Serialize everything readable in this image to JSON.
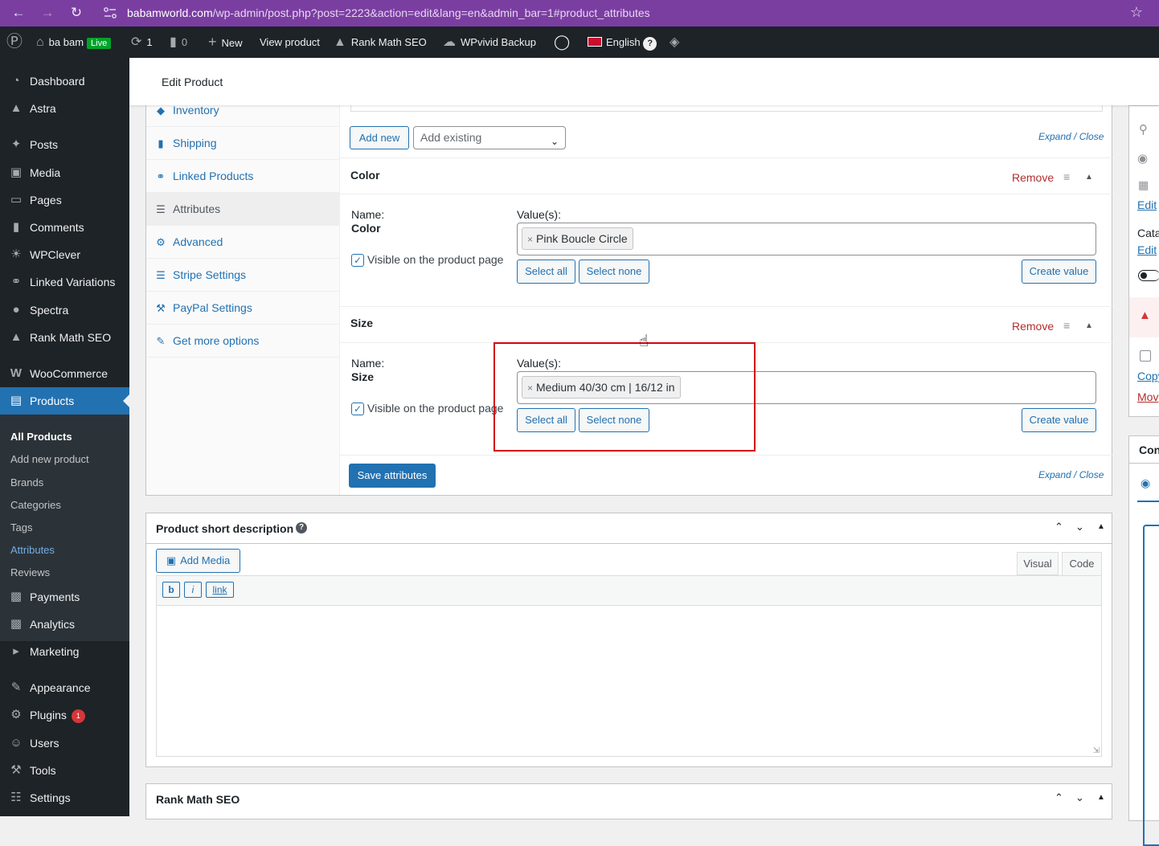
{
  "browser": {
    "url_domain": "babamworld.com",
    "url_path": "/wp-admin/post.php?post=2223&action=edit&lang=en&admin_bar=1#product_attributes"
  },
  "adminbar": {
    "site_name": "ba bam",
    "live_badge": "Live",
    "updates_count": "1",
    "comments_count": "0",
    "new_label": "New",
    "view_product": "View product",
    "rank_math": "Rank Math SEO",
    "wpvivid": "WPvivid Backup",
    "language": "English"
  },
  "sidebar": {
    "items": [
      {
        "label": "Dashboard",
        "icon": "dashboard-icon"
      },
      {
        "label": "Astra",
        "icon": "astra-icon"
      },
      {
        "label": "Posts",
        "icon": "pin-icon"
      },
      {
        "label": "Media",
        "icon": "media-icon"
      },
      {
        "label": "Pages",
        "icon": "page-icon"
      },
      {
        "label": "Comments",
        "icon": "comment-icon"
      },
      {
        "label": "WPClever",
        "icon": "bulb-icon"
      },
      {
        "label": "Linked Variations",
        "icon": "link-icon"
      },
      {
        "label": "Spectra",
        "icon": "spectra-icon"
      },
      {
        "label": "Rank Math SEO",
        "icon": "rankmath-icon"
      },
      {
        "label": "WooCommerce",
        "icon": "woo-icon"
      },
      {
        "label": "Products",
        "icon": "archive-icon"
      },
      {
        "label": "Payments",
        "icon": "payments-icon"
      },
      {
        "label": "Analytics",
        "icon": "chart-icon"
      },
      {
        "label": "Marketing",
        "icon": "megaphone-icon"
      },
      {
        "label": "Appearance",
        "icon": "brush-icon"
      },
      {
        "label": "Plugins",
        "icon": "plugin-icon",
        "badge": "1"
      },
      {
        "label": "Users",
        "icon": "users-icon"
      },
      {
        "label": "Tools",
        "icon": "wrench-icon"
      },
      {
        "label": "Settings",
        "icon": "settings-icon"
      }
    ],
    "submenu": [
      "All Products",
      "Add new product",
      "Brands",
      "Categories",
      "Tags",
      "Attributes",
      "Reviews"
    ]
  },
  "header": {
    "title": "Edit Product"
  },
  "product_data": {
    "tabs": [
      "Inventory",
      "Shipping",
      "Linked Products",
      "Attributes",
      "Advanced",
      "Stripe Settings",
      "PayPal Settings",
      "Get more options"
    ],
    "add_new": "Add new",
    "add_existing_placeholder": "Add existing",
    "expand_close": "Expand / Close",
    "attributes": [
      {
        "title": "Color",
        "remove": "Remove",
        "name_label": "Name:",
        "name_value": "Color",
        "values_label": "Value(s):",
        "value_chip": "Pink Boucle Circle",
        "visible_label": "Visible on the product page",
        "select_all": "Select all",
        "select_none": "Select none",
        "create_value": "Create value"
      },
      {
        "title": "Size",
        "remove": "Remove",
        "name_label": "Name:",
        "name_value": "Size",
        "values_label": "Value(s):",
        "value_chip": "Medium 40/30 cm | 16/12 in",
        "visible_label": "Visible on the product page",
        "select_all": "Select all",
        "select_none": "Select none",
        "create_value": "Create value"
      }
    ],
    "save_attributes": "Save attributes"
  },
  "short_description": {
    "title": "Product short description",
    "add_media": "Add Media",
    "visual_tab": "Visual",
    "code_tab": "Code",
    "qtags": [
      "b",
      "i",
      "link"
    ]
  },
  "rank_math_panel": {
    "title": "Rank Math SEO"
  },
  "right_sidebar": {
    "edit1": "Edit",
    "cata": "Cata",
    "edit2": "Edit",
    "copy": "Copy",
    "move": "Mov",
    "con": "Con"
  },
  "colors": {
    "browser_bar": "#7a3ea1",
    "admin_dark": "#1d2327",
    "accent_blue": "#2271b1",
    "remove_red": "#b32d2e",
    "highlight_red": "#d0021b"
  }
}
